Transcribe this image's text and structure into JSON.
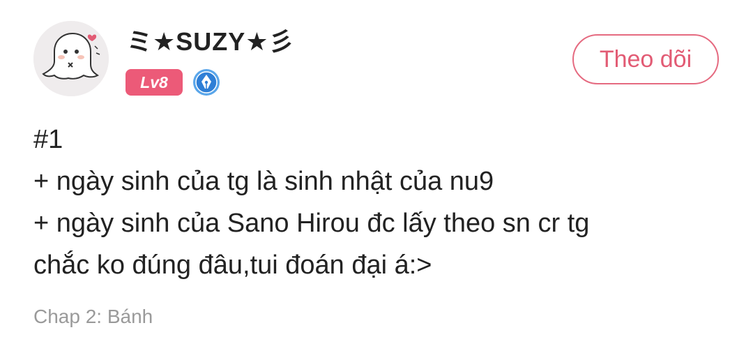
{
  "user": {
    "avatar_icon": "ghost-avatar-icon",
    "username": "ミ★SUZY★彡",
    "level": "Lv8",
    "level_color": "#ec5a78",
    "badge_icon": "writer-pen-badge-icon"
  },
  "follow_button": {
    "label": "Theo dõi",
    "color": "#e25b74"
  },
  "comment": {
    "lines": [
      "#1",
      "+ ngày sinh của tg là sinh nhật của nu9",
      "+ ngày sinh của Sano Hirou đc lấy theo sn cr tg",
      "chắc ko đúng đâu,tui đoán đại á:>"
    ]
  },
  "chapter": {
    "label": "Chap 2: Bánh"
  }
}
